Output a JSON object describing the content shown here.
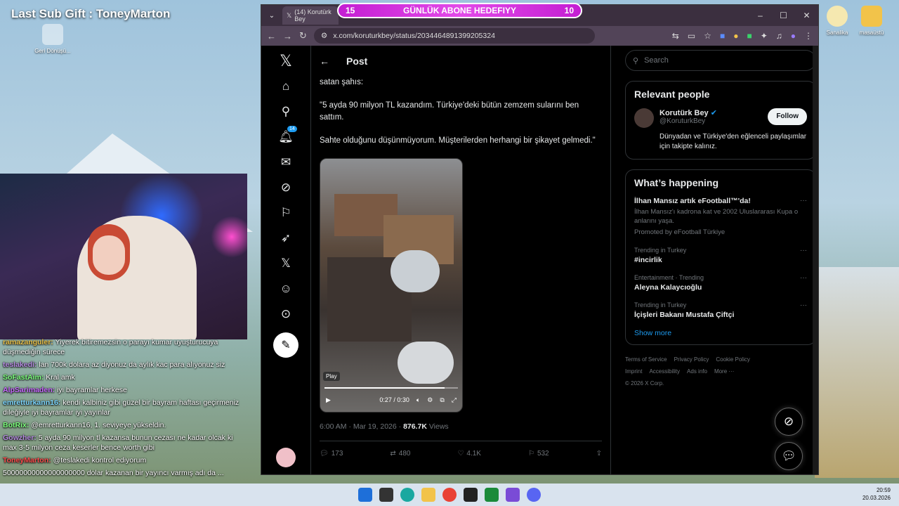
{
  "overlay": {
    "gift_text": "Last Sub Gift : ToneyMarton",
    "desktop_icon_left": "Geri Dönüşü...",
    "desktop_icon_right1": "Sanalika",
    "desktop_icon_right2": "masaüstü",
    "goal_left": "15",
    "goal_label": "GÜNLÜK ABONE HEDEFIYY",
    "goal_right": "10"
  },
  "chat": [
    {
      "user": "ramazanguler:",
      "text": "Yiyerek bitiremezsin o parayı kumar uyuşturucuya düşmediğin sürece",
      "color": "#e8c04a"
    },
    {
      "user": "teslakedi:",
      "text": "lan 700k dolara az diyonuz da aylık kac para alıyonuz siz",
      "color": "#b58be0"
    },
    {
      "user": "SoFastAim:",
      "text": "Kral amk",
      "color": "#7dff7d"
    },
    {
      "user": "AlpSarimaden:",
      "text": "iyi bayramlar herkese",
      "color": "#c86bff"
    },
    {
      "user": "emretturkann16:",
      "text": "kendi kalbiniz gibi güzel bir bayram haftası geçirmeniz dileğiyle iyi bayramlar iyi yayınlar",
      "color": "#7dd6ff"
    },
    {
      "user": "BotRix:",
      "text": "@emretturkann16, 1. seviyeye yükseldin.",
      "color": "#7dff7d"
    },
    {
      "user": "Gowzher:",
      "text": "5 ayda 90 milyon tl kazansa bunun cezası ne kadar olcak ki max 3-5 milyon ceza keserler bence worth gibi",
      "color": "#b58be0"
    },
    {
      "user": "ToneyMarton:",
      "text": "@teslakedi kontrol ediyorum",
      "color": "#ff4d4d"
    },
    {
      "user": "",
      "text": "50000000000000000000 dolar kazanan bir yayıncı varmış adı da ...",
      "color": "#fff"
    }
  ],
  "browser": {
    "tab_title": "(14) Korutürk Bey",
    "url": "x.com/koruturkbey/status/2034464891399205324"
  },
  "x": {
    "notif_count": "14",
    "header_title": "Post",
    "paragraphs": [
      "satan şahıs:",
      "\"5 ayda 90 milyon TL kazandım. Türkiye'deki bütün zemzem sularını ben sattım.",
      "Sahte olduğunu düşünmüyorum. Müşterilerden herhangi bir şikayet gelmedi.\""
    ],
    "video": {
      "tooltip": "Play",
      "time": "0:27 / 0:30",
      "progress": 0.9
    },
    "meta_time": "6:00 AM · Mar 19, 2026 · ",
    "views_count": "876.7K",
    "views_label": " Views",
    "actions": {
      "replies": "173",
      "reposts": "480",
      "likes": "4.1K",
      "bookmarks": "532"
    },
    "search_placeholder": "Search",
    "relevant": {
      "title": "Relevant people",
      "name": "Korutürk Bey",
      "handle": "@KoruturkBey",
      "follow": "Follow",
      "bio": "Dünyadan ve Türkiye'den eğlenceli paylaşımlar için takipte kalınız."
    },
    "happening": {
      "title": "What’s happening",
      "trends": [
        {
          "cat": "",
          "name": "İlhan Mansız artık eFootball™'da!",
          "sub": "İlhan Mansız'ı kadrona kat ve 2002 Uluslararası Kupa o anlarını yaşa.",
          "promo": "Promoted by eFootball Türkiye"
        },
        {
          "cat": "Trending in Turkey",
          "name": "#incirlik",
          "sub": "",
          "promo": ""
        },
        {
          "cat": "Entertainment · Trending",
          "name": "Aleyna Kalaycıoğlu",
          "sub": "",
          "promo": ""
        },
        {
          "cat": "Trending in Turkey",
          "name": "İçişleri Bakanı Mustafa Çiftçi",
          "sub": "",
          "promo": ""
        }
      ],
      "show_more": "Show more"
    },
    "footer": [
      "Terms of Service",
      "Privacy Policy",
      "Cookie Policy",
      "Imprint",
      "Accessibility",
      "Ads info",
      "More ···",
      "© 2026 X Corp."
    ]
  },
  "taskbar": {
    "time": "20:59",
    "date": "20.03.2026"
  }
}
